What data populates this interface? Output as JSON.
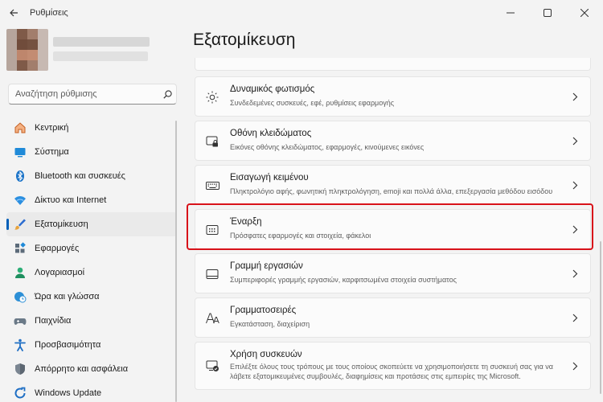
{
  "window": {
    "title": "Ρυθμίσεις",
    "controls": {
      "minimize": "—",
      "maximize": "☐",
      "close": "✕"
    }
  },
  "search": {
    "placeholder": "Αναζήτηση ρύθμισης"
  },
  "sidebar": {
    "items": [
      {
        "label": "Κεντρική",
        "icon": "home-icon"
      },
      {
        "label": "Σύστημα",
        "icon": "system-icon"
      },
      {
        "label": "Bluetooth και συσκευές",
        "icon": "bluetooth-icon"
      },
      {
        "label": "Δίκτυο και Internet",
        "icon": "wifi-icon"
      },
      {
        "label": "Εξατομίκευση",
        "icon": "brush-icon",
        "selected": true
      },
      {
        "label": "Εφαρμογές",
        "icon": "apps-icon"
      },
      {
        "label": "Λογαριασμοί",
        "icon": "account-icon"
      },
      {
        "label": "Ώρα και γλώσσα",
        "icon": "globe-clock-icon"
      },
      {
        "label": "Παιχνίδια",
        "icon": "gamepad-icon"
      },
      {
        "label": "Προσβασιμότητα",
        "icon": "accessibility-icon"
      },
      {
        "label": "Απόρρητο και ασφάλεια",
        "icon": "shield-icon"
      },
      {
        "label": "Windows Update",
        "icon": "update-icon"
      }
    ]
  },
  "main": {
    "title": "Εξατομίκευση",
    "cards": [
      {
        "title": "Δυναμικός φωτισμός",
        "subtitle": "Συνδεδεμένες συσκευές, εφέ, ρυθμίσεις εφαρμογής",
        "icon": "dynamic-lighting-icon"
      },
      {
        "title": "Οθόνη κλειδώματος",
        "subtitle": "Εικόνες οθόνης κλειδώματος, εφαρμογές, κινούμενες εικόνες",
        "icon": "lock-screen-icon"
      },
      {
        "title": "Εισαγωγή κειμένου",
        "subtitle": "Πληκτρολόγιο αφής, φωνητική πληκτρολόγηση, emoji και πολλά άλλα, επεξεργασία μεθόδου εισόδου",
        "icon": "keyboard-icon"
      },
      {
        "title": "Έναρξη",
        "subtitle": "Πρόσφατες εφαρμογές και στοιχεία, φάκελοι",
        "icon": "start-icon",
        "highlighted": true
      },
      {
        "title": "Γραμμή εργασιών",
        "subtitle": "Συμπεριφορές γραμμής εργασιών, καρφιτσωμένα στοιχεία συστήματος",
        "icon": "taskbar-icon"
      },
      {
        "title": "Γραμματοσειρές",
        "subtitle": "Εγκατάσταση, διαχείριση",
        "icon": "fonts-icon"
      },
      {
        "title": "Χρήση συσκευών",
        "subtitle": "Επιλέξτε όλους τους τρόπους με τους οποίους σκοπεύετε να χρησιμοποιήσετε τη συσκευή σας για να λάβετε εξατομικευμένες συμβουλές, διαφημίσεις και προτάσεις στις εμπειρίες της Microsoft.",
        "icon": "device-usage-icon"
      }
    ]
  },
  "colors": {
    "accent": "#005fb8",
    "highlight": "#d8121a"
  }
}
